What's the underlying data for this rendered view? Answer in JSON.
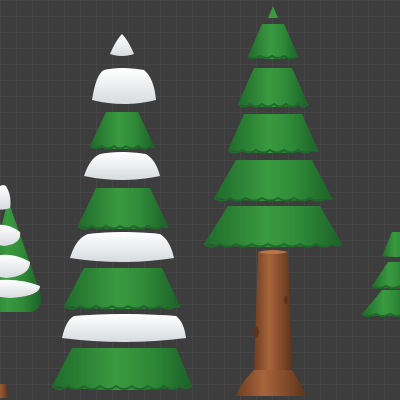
{
  "viewport": {
    "background": "#3d3d3d",
    "grid": true
  },
  "colors": {
    "foliage": "#2f8a3a",
    "foliage_light": "#4fae4c",
    "foliage_dark": "#1e6a2a",
    "snow": "#f2f2f2",
    "snow_shadow": "#cfd3d6",
    "trunk": "#9a5a32",
    "trunk_dark": "#6e3d22"
  },
  "scene": {
    "objects": [
      "tree-left-partial-snowy",
      "tree-snow-tiered",
      "tree-pine-tall",
      "tree-right-partial"
    ]
  }
}
